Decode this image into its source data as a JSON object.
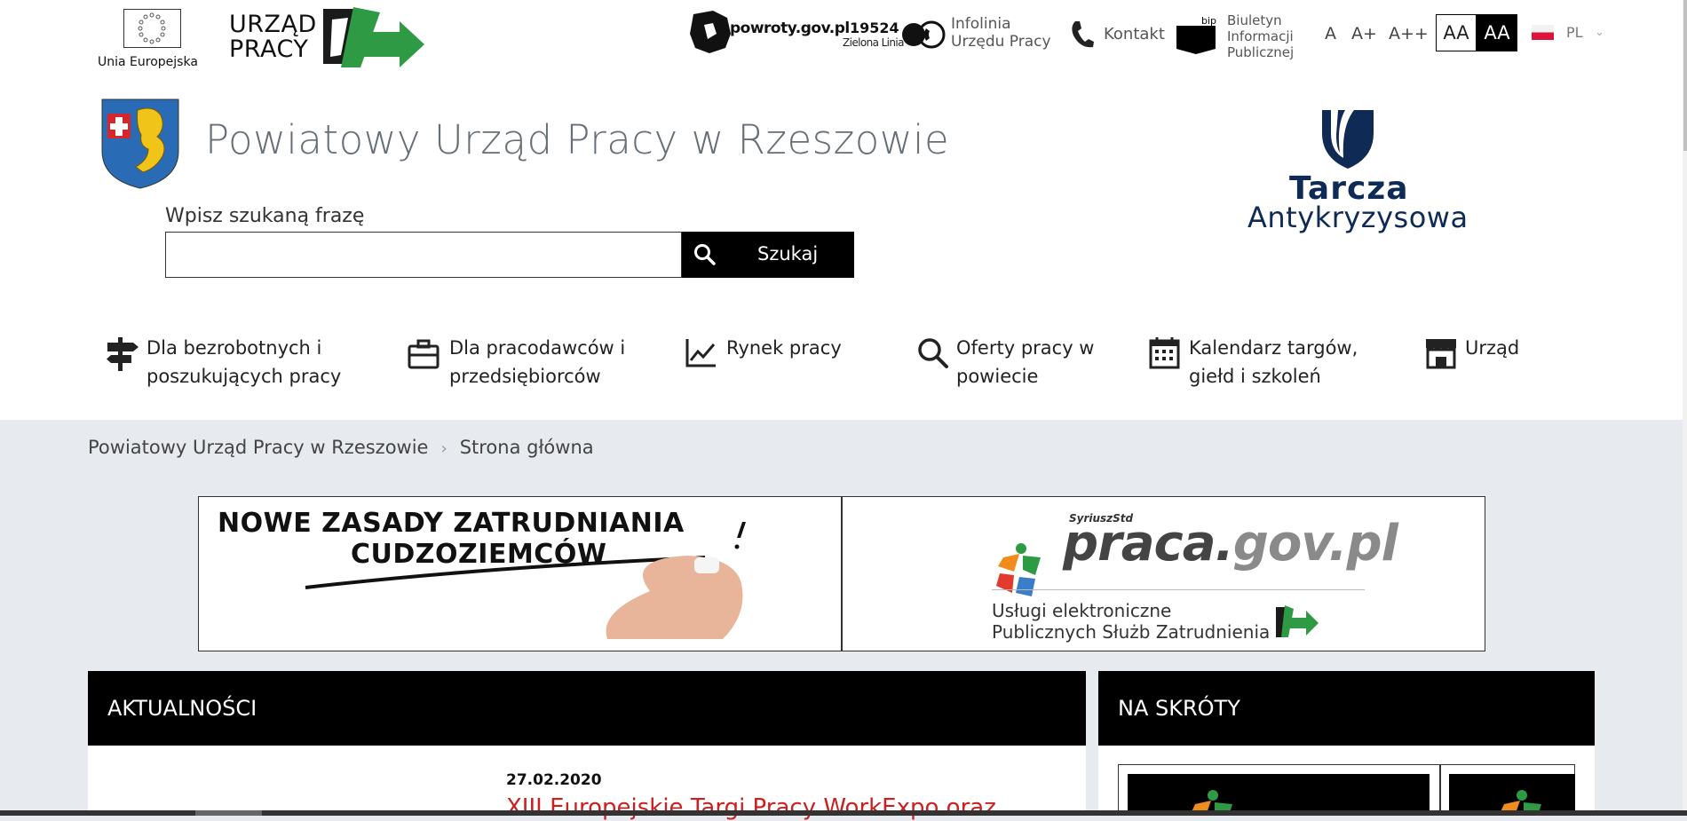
{
  "header": {
    "eu_label": "Unia Europejska",
    "urzad_pracy_line1": "URZĄD",
    "urzad_pracy_line2": "PRACY",
    "powroty": "powroty.gov.pl",
    "zielona_number": "19524",
    "zielona_label": "Zielona Linia",
    "infolinia_line1": "Infolinia",
    "infolinia_line2": "Urzędu Pracy",
    "kontakt": "Kontakt",
    "bip_badge": "bip",
    "bip_line1": "Biuletyn",
    "bip_line2": "Informacji",
    "bip_line3": "Publicznej",
    "font_small": "A",
    "font_medium": "A+",
    "font_large": "A++",
    "contrast_normal": "AA",
    "contrast_high": "AA",
    "language": "PL"
  },
  "site": {
    "title": "Powiatowy Urząd Pracy w Rzeszowie",
    "tarcza_line1": "Tarcza",
    "tarcza_line2": "Antykryzysowa"
  },
  "search": {
    "label": "Wpisz szukaną frazę",
    "value": "",
    "button": "Szukaj"
  },
  "nav": [
    {
      "label_line1": "Dla bezrobotnych i",
      "label_line2": "poszukujących pracy",
      "icon": "signpost-icon"
    },
    {
      "label_line1": "Dla pracodawców i",
      "label_line2": "przedsiębiorców",
      "icon": "briefcase-icon"
    },
    {
      "label_line1": "Rynek pracy",
      "label_line2": "",
      "icon": "chart-icon"
    },
    {
      "label_line1": "Oferty pracy w",
      "label_line2": "powiecie",
      "icon": "search-icon"
    },
    {
      "label_line1": "Kalendarz targów,",
      "label_line2": "giełd i szkoleń",
      "icon": "calendar-icon"
    },
    {
      "label_line1": "Urząd",
      "label_line2": "",
      "icon": "building-icon"
    }
  ],
  "breadcrumb": {
    "root": "Powiatowy Urząd Pracy w Rzeszowie",
    "current": "Strona główna"
  },
  "banners": {
    "b1_line1": "NOWE ZASADY ZATRUDNIANIA",
    "b1_line2": "CUDZOZIEMCÓW",
    "b2_syriusz": "SyriuszStd",
    "b2_praca": "praca.",
    "b2_gov": "gov.pl",
    "b2_line1": "Usługi elektroniczne",
    "b2_line2": "Publicznych Służb Zatrudnienia"
  },
  "news": {
    "heading": "AKTUALNOŚCI",
    "items": [
      {
        "date": "27.02.2020",
        "title": "XIII Europejskie Targi Pracy WorkExpo oraz"
      }
    ]
  },
  "shortcuts": {
    "heading": "NA SKRÓTY"
  },
  "colors": {
    "accent_dark": "#000000",
    "news_title": "#cc1f1f",
    "tarcza": "#0e2a55",
    "up_green": "#2e9a44",
    "page_bg": "#e7eaee"
  }
}
